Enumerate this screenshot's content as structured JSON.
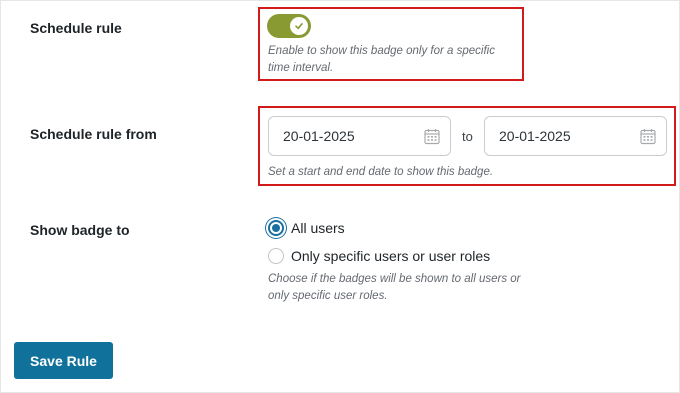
{
  "schedule_rule": {
    "label": "Schedule rule",
    "enabled": true,
    "description": "Enable to show this badge only for a specific time interval."
  },
  "schedule_from": {
    "label": "Schedule rule from",
    "start_date": "20-01-2025",
    "separator": "to",
    "end_date": "20-01-2025",
    "description": "Set a start and end date to show this badge."
  },
  "show_badge": {
    "label": "Show badge to",
    "options": [
      {
        "label": "All users",
        "selected": true
      },
      {
        "label": "Only specific users or user roles",
        "selected": false
      }
    ],
    "description": "Choose if the badges will be shown to all users or only specific user roles."
  },
  "save_button": {
    "label": "Save Rule"
  },
  "colors": {
    "toggle_on": "#8a9a32",
    "highlight": "#d11b1b",
    "primary": "#10729a",
    "radio_accent": "#1b6fa0"
  }
}
